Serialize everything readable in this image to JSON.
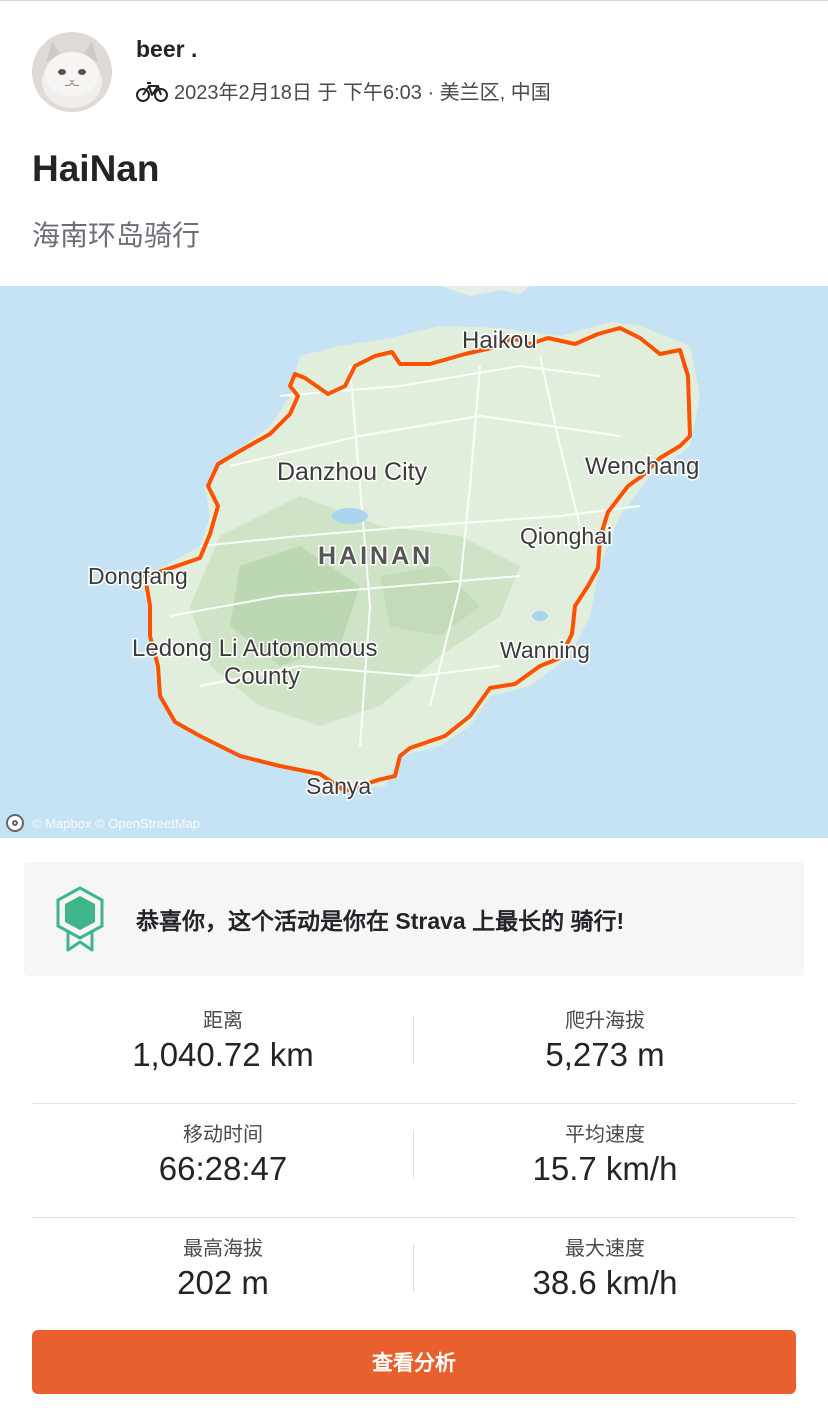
{
  "user": {
    "name": "beer .",
    "activity_meta": "2023年2月18日 于 下午6:03 · 美兰区, 中国"
  },
  "activity": {
    "title": "HaiNan",
    "description": "海南环岛骑行"
  },
  "map": {
    "labels": {
      "haikou": "Haikou",
      "danzhou": "Danzhou City",
      "hainan": "HAINAN",
      "wenchang": "Wenchang",
      "qionghai": "Qionghai",
      "dongfang": "Dongfang",
      "ledong_1": "Ledong Li Autonomous",
      "ledong_2": "County",
      "wanning": "Wanning",
      "sanya": "Sanya"
    },
    "attribution": "© Mapbox © OpenStreetMap",
    "route_color": "#fc5200",
    "water_color": "#c6e3f5",
    "land_color": "#e2eedc"
  },
  "achievement": {
    "text": "恭喜你，这个活动是你在 Strava 上最长的 骑行!"
  },
  "stats": {
    "distance": {
      "label": "距离",
      "value": "1,040.72 km"
    },
    "elevation_gain": {
      "label": "爬升海拔",
      "value": "5,273 m"
    },
    "moving_time": {
      "label": "移动时间",
      "value": "66:28:47"
    },
    "avg_speed": {
      "label": "平均速度",
      "value": "15.7 km/h"
    },
    "max_elevation": {
      "label": "最高海拔",
      "value": "202 m"
    },
    "max_speed": {
      "label": "最大速度",
      "value": "38.6 km/h"
    }
  },
  "cta": {
    "label": "查看分析"
  },
  "colors": {
    "accent": "#e8602d",
    "text": "#242428",
    "muted": "#6d6d78"
  }
}
